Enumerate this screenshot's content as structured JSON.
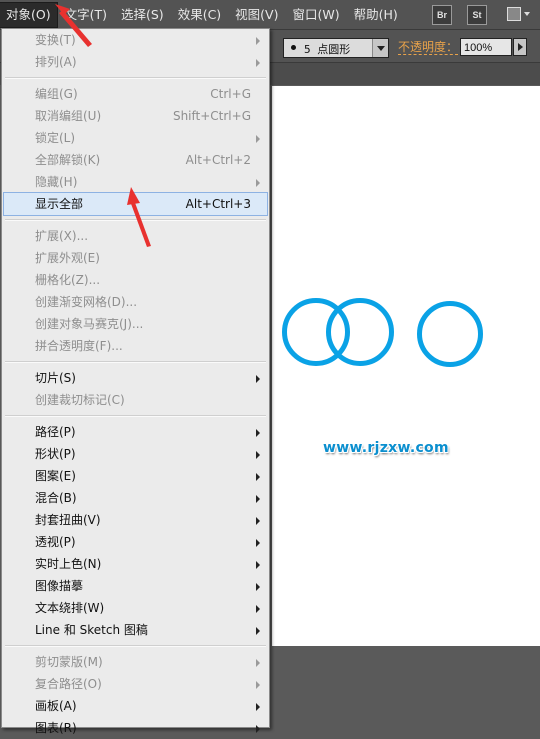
{
  "menubar": {
    "items": [
      {
        "label": "对象(O)",
        "active": true
      },
      {
        "label": "文字(T)"
      },
      {
        "label": "选择(S)"
      },
      {
        "label": "效果(C)"
      },
      {
        "label": "视图(V)"
      },
      {
        "label": "窗口(W)"
      },
      {
        "label": "帮助(H)"
      }
    ],
    "bridge_label": "Br",
    "stock_label": "St"
  },
  "control": {
    "brush_label": "5 点圆形",
    "opacity_label": "不透明度：",
    "opacity_value": "100%"
  },
  "dropdown": {
    "groups": [
      [
        {
          "label": "变换(T)",
          "disabled": true,
          "sub": true
        },
        {
          "label": "排列(A)",
          "disabled": true,
          "sub": true
        }
      ],
      [
        {
          "label": "编组(G)",
          "disabled": true,
          "shortcut": "Ctrl+G"
        },
        {
          "label": "取消编组(U)",
          "disabled": true,
          "shortcut": "Shift+Ctrl+G"
        },
        {
          "label": "锁定(L)",
          "disabled": true,
          "sub": true
        },
        {
          "label": "全部解锁(K)",
          "disabled": true,
          "shortcut": "Alt+Ctrl+2"
        },
        {
          "label": "隐藏(H)",
          "disabled": true,
          "sub": true
        },
        {
          "label": "显示全部",
          "highlight": true,
          "shortcut": "Alt+Ctrl+3"
        }
      ],
      [
        {
          "label": "扩展(X)...",
          "disabled": true
        },
        {
          "label": "扩展外观(E)",
          "disabled": true
        },
        {
          "label": "栅格化(Z)...",
          "disabled": true
        },
        {
          "label": "创建渐变网格(D)...",
          "disabled": true
        },
        {
          "label": "创建对象马赛克(J)...",
          "disabled": true
        },
        {
          "label": "拼合透明度(F)...",
          "disabled": true
        }
      ],
      [
        {
          "label": "切片(S)",
          "sub": true
        },
        {
          "label": "创建裁切标记(C)",
          "disabled": true
        }
      ],
      [
        {
          "label": "路径(P)",
          "sub": true
        },
        {
          "label": "形状(P)",
          "sub": true
        },
        {
          "label": "图案(E)",
          "sub": true
        },
        {
          "label": "混合(B)",
          "sub": true
        },
        {
          "label": "封套扭曲(V)",
          "sub": true
        },
        {
          "label": "透视(P)",
          "sub": true
        },
        {
          "label": "实时上色(N)",
          "sub": true
        },
        {
          "label": "图像描摹",
          "sub": true
        },
        {
          "label": "文本绕排(W)",
          "sub": true
        },
        {
          "label": "Line 和 Sketch 图稿",
          "sub": true
        }
      ],
      [
        {
          "label": "剪切蒙版(M)",
          "disabled": true,
          "sub": true
        },
        {
          "label": "复合路径(O)",
          "disabled": true,
          "sub": true
        },
        {
          "label": "画板(A)",
          "sub": true
        },
        {
          "label": "图表(R)",
          "sub": true
        }
      ]
    ]
  },
  "canvas": {
    "watermark": "www.rjzxw.com",
    "ring_color": "#0aa2e6"
  },
  "colors": {
    "annotation_arrow": "#e8312f",
    "highlight": "#dbe9f8"
  }
}
